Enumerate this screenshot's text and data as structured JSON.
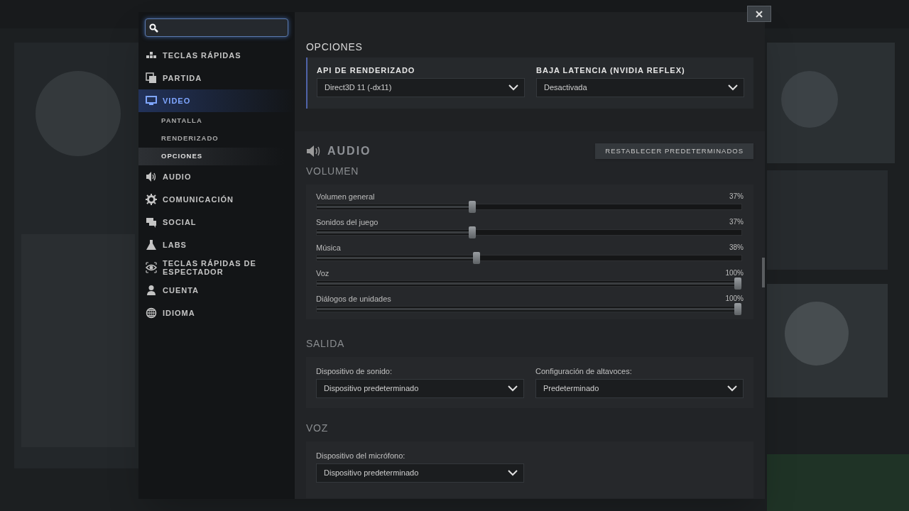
{
  "sidebar": {
    "items": [
      {
        "label": "TECLAS RÁPIDAS",
        "selected": false
      },
      {
        "label": "PARTIDA",
        "selected": false
      },
      {
        "label": "VIDEO",
        "selected": true,
        "children": [
          {
            "label": "PANTALLA",
            "selected": false
          },
          {
            "label": "RENDERIZADO",
            "selected": false
          },
          {
            "label": "OPCIONES",
            "selected": true
          }
        ]
      },
      {
        "label": "AUDIO",
        "selected": false
      },
      {
        "label": "COMUNICACIÓN",
        "selected": false
      },
      {
        "label": "SOCIAL",
        "selected": false
      },
      {
        "label": "LABS",
        "selected": false
      },
      {
        "label": "TECLAS RÁPIDAS DE ESPECTADOR",
        "selected": false
      },
      {
        "label": "CUENTA",
        "selected": false
      },
      {
        "label": "IDIOMA",
        "selected": false
      }
    ]
  },
  "options": {
    "title": "OPCIONES",
    "fields": [
      {
        "label": "API DE RENDERIZADO",
        "value": "Direct3D 11 (-dx11)"
      },
      {
        "label": "BAJA LATENCIA (NVIDIA REFLEX)",
        "value": "Desactivada"
      }
    ]
  },
  "audio": {
    "title": "AUDIO",
    "reset_button": "RESTABLECER PREDETERMINADOS",
    "volume": {
      "title": "VOLUMEN",
      "sliders": [
        {
          "name": "Volumen general",
          "level": 0.37,
          "reading": "37%"
        },
        {
          "name": "Sonidos del juego",
          "level": 0.37,
          "reading": "37%"
        },
        {
          "name": "Música",
          "level": 0.38,
          "reading": "38%"
        },
        {
          "name": "Voz",
          "level": 1,
          "reading": "100%"
        },
        {
          "name": "Diálogos de unidades",
          "level": 1,
          "reading": "100%"
        }
      ]
    },
    "output": {
      "title": "SALIDA",
      "fields": [
        {
          "label": "Dispositivo de sonido:",
          "value": "Dispositivo predeterminado"
        },
        {
          "label": "Configuración de altavoces:",
          "value": "Predeterminado"
        }
      ]
    },
    "voice": {
      "title": "VOZ",
      "fields": [
        {
          "label": "Dispositivo del micrófono:",
          "value": "Dispositivo predeterminado"
        }
      ]
    }
  }
}
